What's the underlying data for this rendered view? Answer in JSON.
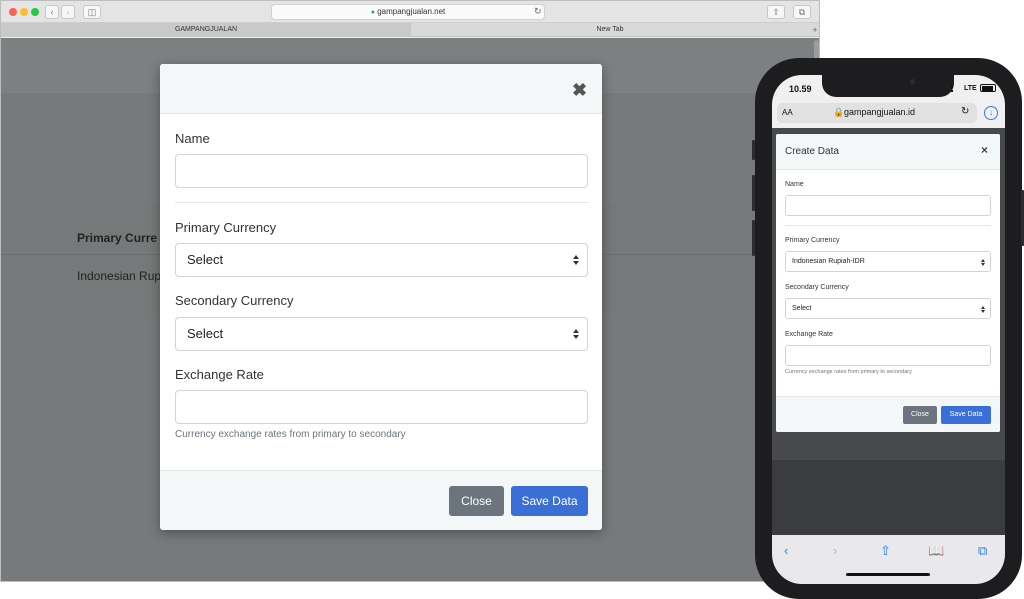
{
  "browser": {
    "url": "gampangjualan.net",
    "tabs": [
      "GAMPANGJUALAN",
      "New Tab"
    ],
    "background": {
      "column_header": "Primary Curre",
      "row_value": "Indonesian Rup"
    }
  },
  "modal": {
    "name_label": "Name",
    "name_value": "",
    "primary_currency_label": "Primary Currency",
    "primary_currency_value": "Select",
    "secondary_currency_label": "Secondary Currency",
    "secondary_currency_value": "Select",
    "exchange_rate_label": "Exchange Rate",
    "exchange_rate_value": "",
    "exchange_rate_help": "Currency exchange rates from primary to secondary",
    "close_label": "Close",
    "save_label": "Save Data"
  },
  "phone": {
    "time": "10.59",
    "network": "LTE",
    "text_size_label": "AA",
    "url": "gampangjualan.id",
    "modal": {
      "title": "Create Data",
      "close_x": "×",
      "name_label": "Name",
      "primary_currency_label": "Primary Currency",
      "primary_currency_value": "Indonesian Rupiah-IDR",
      "secondary_currency_label": "Secondary Currency",
      "secondary_currency_value": "Select",
      "exchange_rate_label": "Exchange Rate",
      "exchange_rate_help": "Currency exchange rates from primary to secondary",
      "close_label": "Close",
      "save_label": "Save Data"
    }
  },
  "icons": {
    "modal_close": "close-icon",
    "secure": "lock-icon",
    "reload": "reload-icon",
    "download": "download-icon"
  },
  "colors": {
    "primary": "#3b6fd8",
    "secondary": "#6c757d",
    "overlay": "#777a7b"
  }
}
